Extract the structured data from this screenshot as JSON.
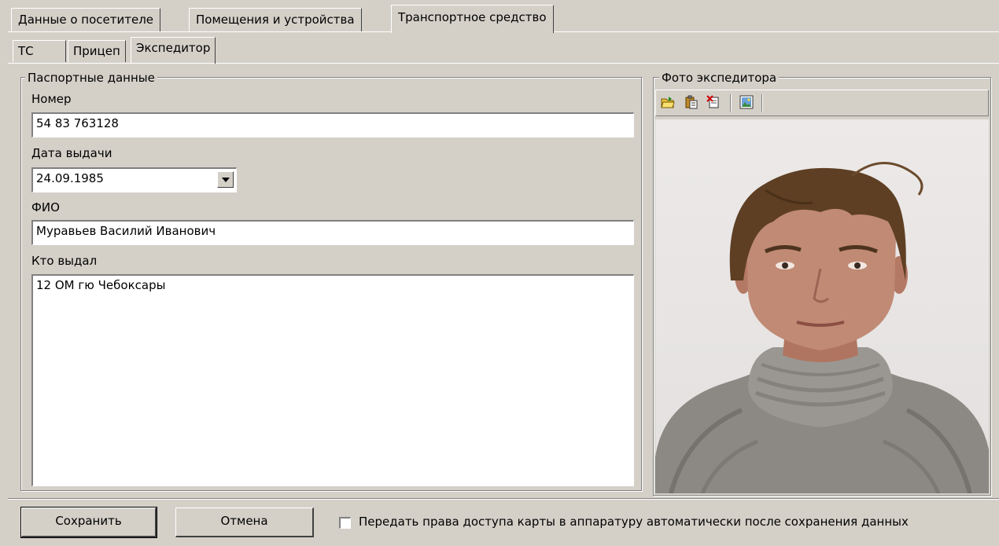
{
  "tabs": [
    {
      "label": "Данные о посетителе"
    },
    {
      "label": "Помещения и устройства"
    },
    {
      "label": "Транспортное средство",
      "active": true
    }
  ],
  "subtabs": [
    {
      "label": "ТС"
    },
    {
      "label": "Прицеп"
    },
    {
      "label": "Экспедитор",
      "active": true
    }
  ],
  "passport": {
    "legend": "Паспортные данные",
    "number_label": "Номер",
    "number_value": "54 83 763128",
    "date_label": "Дата выдачи",
    "date_value": "24.09.1985",
    "fio_label": "ФИО",
    "fio_value": "Муравьев Василий Иванович",
    "issued_label": "Кто выдал",
    "issued_value": "12 ОМ гю Чебоксары"
  },
  "photo": {
    "legend": "Фото экспедитора",
    "toolbar_icons": [
      "open-folder-icon",
      "paste-icon",
      "clear-icon",
      "load-image-icon"
    ]
  },
  "footer": {
    "save_label": "Сохранить",
    "cancel_label": "Отмена",
    "checkbox_label": "Передать права доступа карты в аппаратуру автоматически после сохранения данных",
    "checkbox_checked": false
  }
}
